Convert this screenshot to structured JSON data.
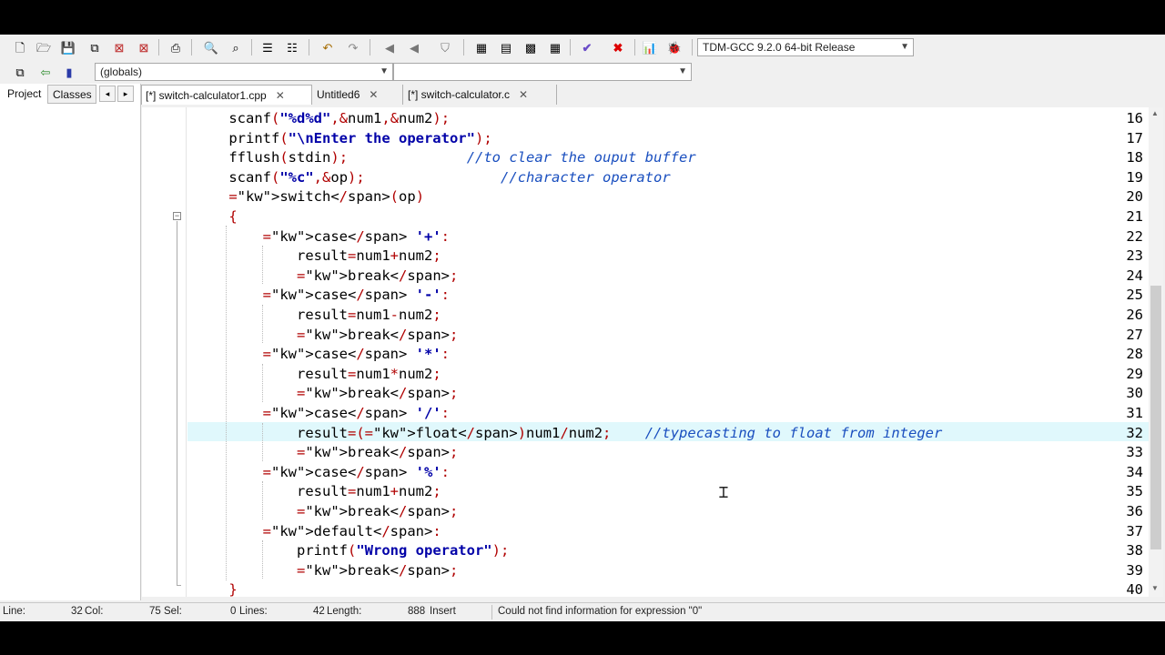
{
  "toolbar": {
    "compiler_select": "TDM-GCC 9.2.0 64-bit Release",
    "scope_select": "(globals)",
    "member_select": ""
  },
  "panel_tabs": [
    "Project",
    "Classes"
  ],
  "file_tabs": [
    {
      "label": "[*] switch-calculator1.cpp",
      "active": true
    },
    {
      "label": "Untitled6",
      "active": false
    },
    {
      "label": "[*] switch-calculator.c",
      "active": false
    }
  ],
  "editor": {
    "current_line": 32,
    "lines": [
      {
        "n": "16",
        "code": "    scanf(\"%d%d\",&num1,&num2);"
      },
      {
        "n": "17",
        "code": "    printf(\"\\nEnter the operator\");"
      },
      {
        "n": "18",
        "code": "    fflush(stdin);              //to clear the ouput buffer"
      },
      {
        "n": "19",
        "code": "    scanf(\"%c\",&op);                //character operator"
      },
      {
        "n": "20",
        "code": "    switch(op)"
      },
      {
        "n": "21",
        "code": "    {"
      },
      {
        "n": "22",
        "code": "        case '+':"
      },
      {
        "n": "23",
        "code": "            result=num1+num2;"
      },
      {
        "n": "24",
        "code": "            break;"
      },
      {
        "n": "25",
        "code": "        case '-':"
      },
      {
        "n": "26",
        "code": "            result=num1-num2;"
      },
      {
        "n": "27",
        "code": "            break;"
      },
      {
        "n": "28",
        "code": "        case '*':"
      },
      {
        "n": "29",
        "code": "            result=num1*num2;"
      },
      {
        "n": "30",
        "code": "            break;"
      },
      {
        "n": "31",
        "code": "        case '/':"
      },
      {
        "n": "32",
        "code": "            result=(float)num1/num2;    //typecasting to float from integer"
      },
      {
        "n": "33",
        "code": "            break;"
      },
      {
        "n": "34",
        "code": "        case '%':"
      },
      {
        "n": "35",
        "code": "            result=num1+num2;"
      },
      {
        "n": "36",
        "code": "            break;"
      },
      {
        "n": "37",
        "code": "        default:"
      },
      {
        "n": "38",
        "code": "            printf(\"Wrong operator\");"
      },
      {
        "n": "39",
        "code": "            break;"
      },
      {
        "n": "40",
        "code": "    }"
      }
    ]
  },
  "status": {
    "line_label": "Line:",
    "line_value": "32",
    "col_label": "Col:",
    "col_value": "75",
    "sel_label": "Sel:",
    "sel_value": "0",
    "lines_label": "Lines:",
    "lines_value": "42",
    "length_label": "Length:",
    "length_value": "888",
    "mode": "Insert",
    "message": "Could not find information for expression \"0\""
  },
  "colors": {
    "current_line_bg": "#e0f8fc",
    "comment": "#1a4fbf",
    "string": "#0000a8",
    "symbol": "#b00000"
  }
}
